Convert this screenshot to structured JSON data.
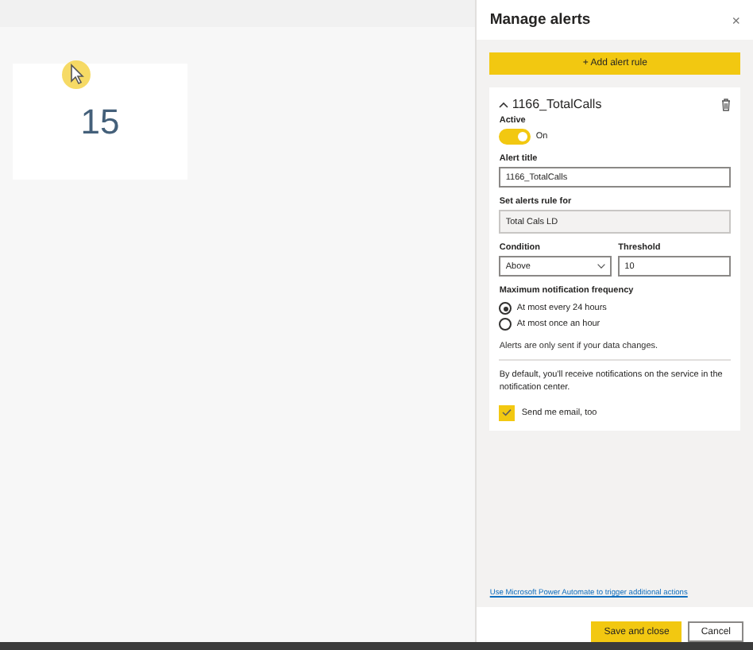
{
  "tile": {
    "value": "15"
  },
  "panel": {
    "title": "Manage alerts",
    "close": "×",
    "add_button": "+ Add alert rule",
    "rule": {
      "name": "1166_TotalCalls",
      "expanded": true,
      "active": {
        "label": "Active",
        "on": true,
        "state_text": "On"
      },
      "alert_title": {
        "label": "Alert title",
        "value": "1166_TotalCalls"
      },
      "rule_for": {
        "label": "Set alerts rule for",
        "value": "Total Cals LD",
        "disabled": true
      },
      "condition": {
        "label": "Condition",
        "value": "Above"
      },
      "threshold": {
        "label": "Threshold",
        "value": "10"
      },
      "frequency": {
        "label": "Maximum notification frequency",
        "options": [
          {
            "label": "At most every 24 hours",
            "selected": true
          },
          {
            "label": "At most once an hour",
            "selected": false
          }
        ]
      },
      "note": "Alerts are only sent if your data changes.",
      "default_info": "By default, you'll receive notifications on the service in the notification center.",
      "email": {
        "label": "Send me email, too",
        "checked": true
      }
    },
    "automate_link": "Use Microsoft Power Automate to trigger additional actions",
    "buttons": [
      {
        "label": "Save and close",
        "kind": "primary"
      },
      {
        "label": "Cancel",
        "kind": "secondary"
      }
    ]
  }
}
